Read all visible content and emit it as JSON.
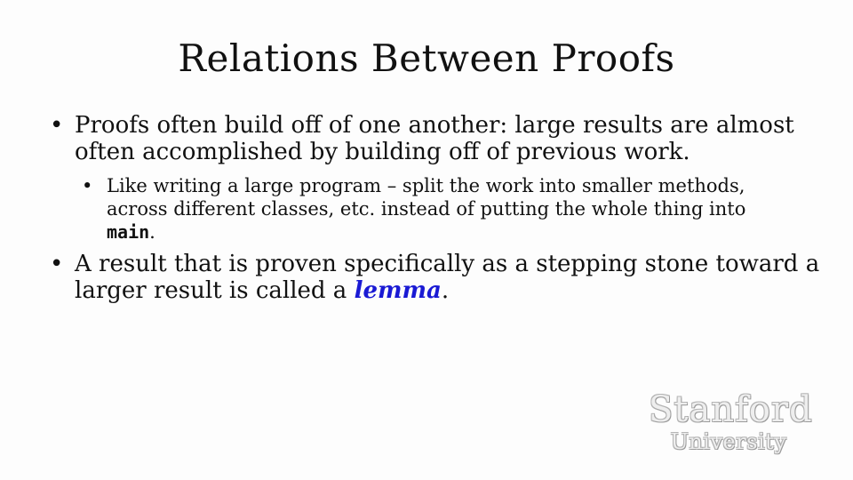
{
  "slide": {
    "title": "Relations Between Proofs",
    "bullets": [
      {
        "text": "Proofs often build off of one another: large results are almost often accomplished by building off of previous work.",
        "sub": {
          "text_before": "Like writing a large program – split the work into smaller methods, across different classes, etc. instead of putting the whole thing into ",
          "code": "main",
          "text_after": "."
        }
      },
      {
        "text_before": "A result that is proven specifically as a stepping stone toward a larger result is called a ",
        "term": "lemma",
        "text_after": "."
      }
    ],
    "bullet_glyph": "•"
  },
  "logo": {
    "line1": "Stanford",
    "line2": "University"
  },
  "colors": {
    "term": "#1a1ad4",
    "background": "#fdfdfd"
  }
}
